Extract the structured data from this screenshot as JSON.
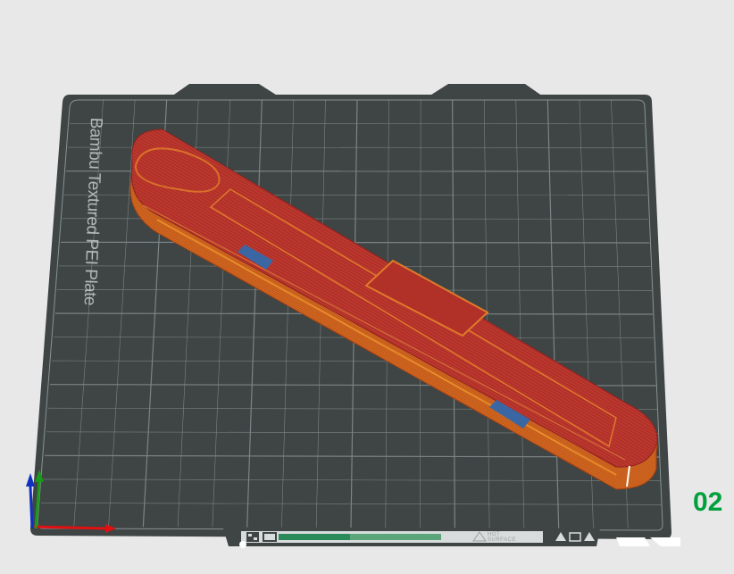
{
  "app": {
    "view": "3D Prepare Viewport"
  },
  "build_plate": {
    "label": "Bambu Textured PEI Plate",
    "number_text": "02",
    "hint_text_line1": "HOT",
    "hint_text_line2": "SURFACE"
  },
  "colors": {
    "background": "#e8e8e8",
    "plate": "#3f4444",
    "grid": "#7b8484",
    "model_top": "#b2302a",
    "model_side": "#c45a1a",
    "overhang": "#3a67a3",
    "plate_number": "#00a03c",
    "axis_x": "#e01010",
    "axis_y": "#1a9a1a",
    "axis_z": "#1030c0"
  },
  "icons": {
    "axis_gizmo": "xyz-axis-icon",
    "qr_code": "qr-code-icon",
    "plate_icon": "plate-type-icon",
    "hot_surface": "warning-triangle-icon"
  }
}
